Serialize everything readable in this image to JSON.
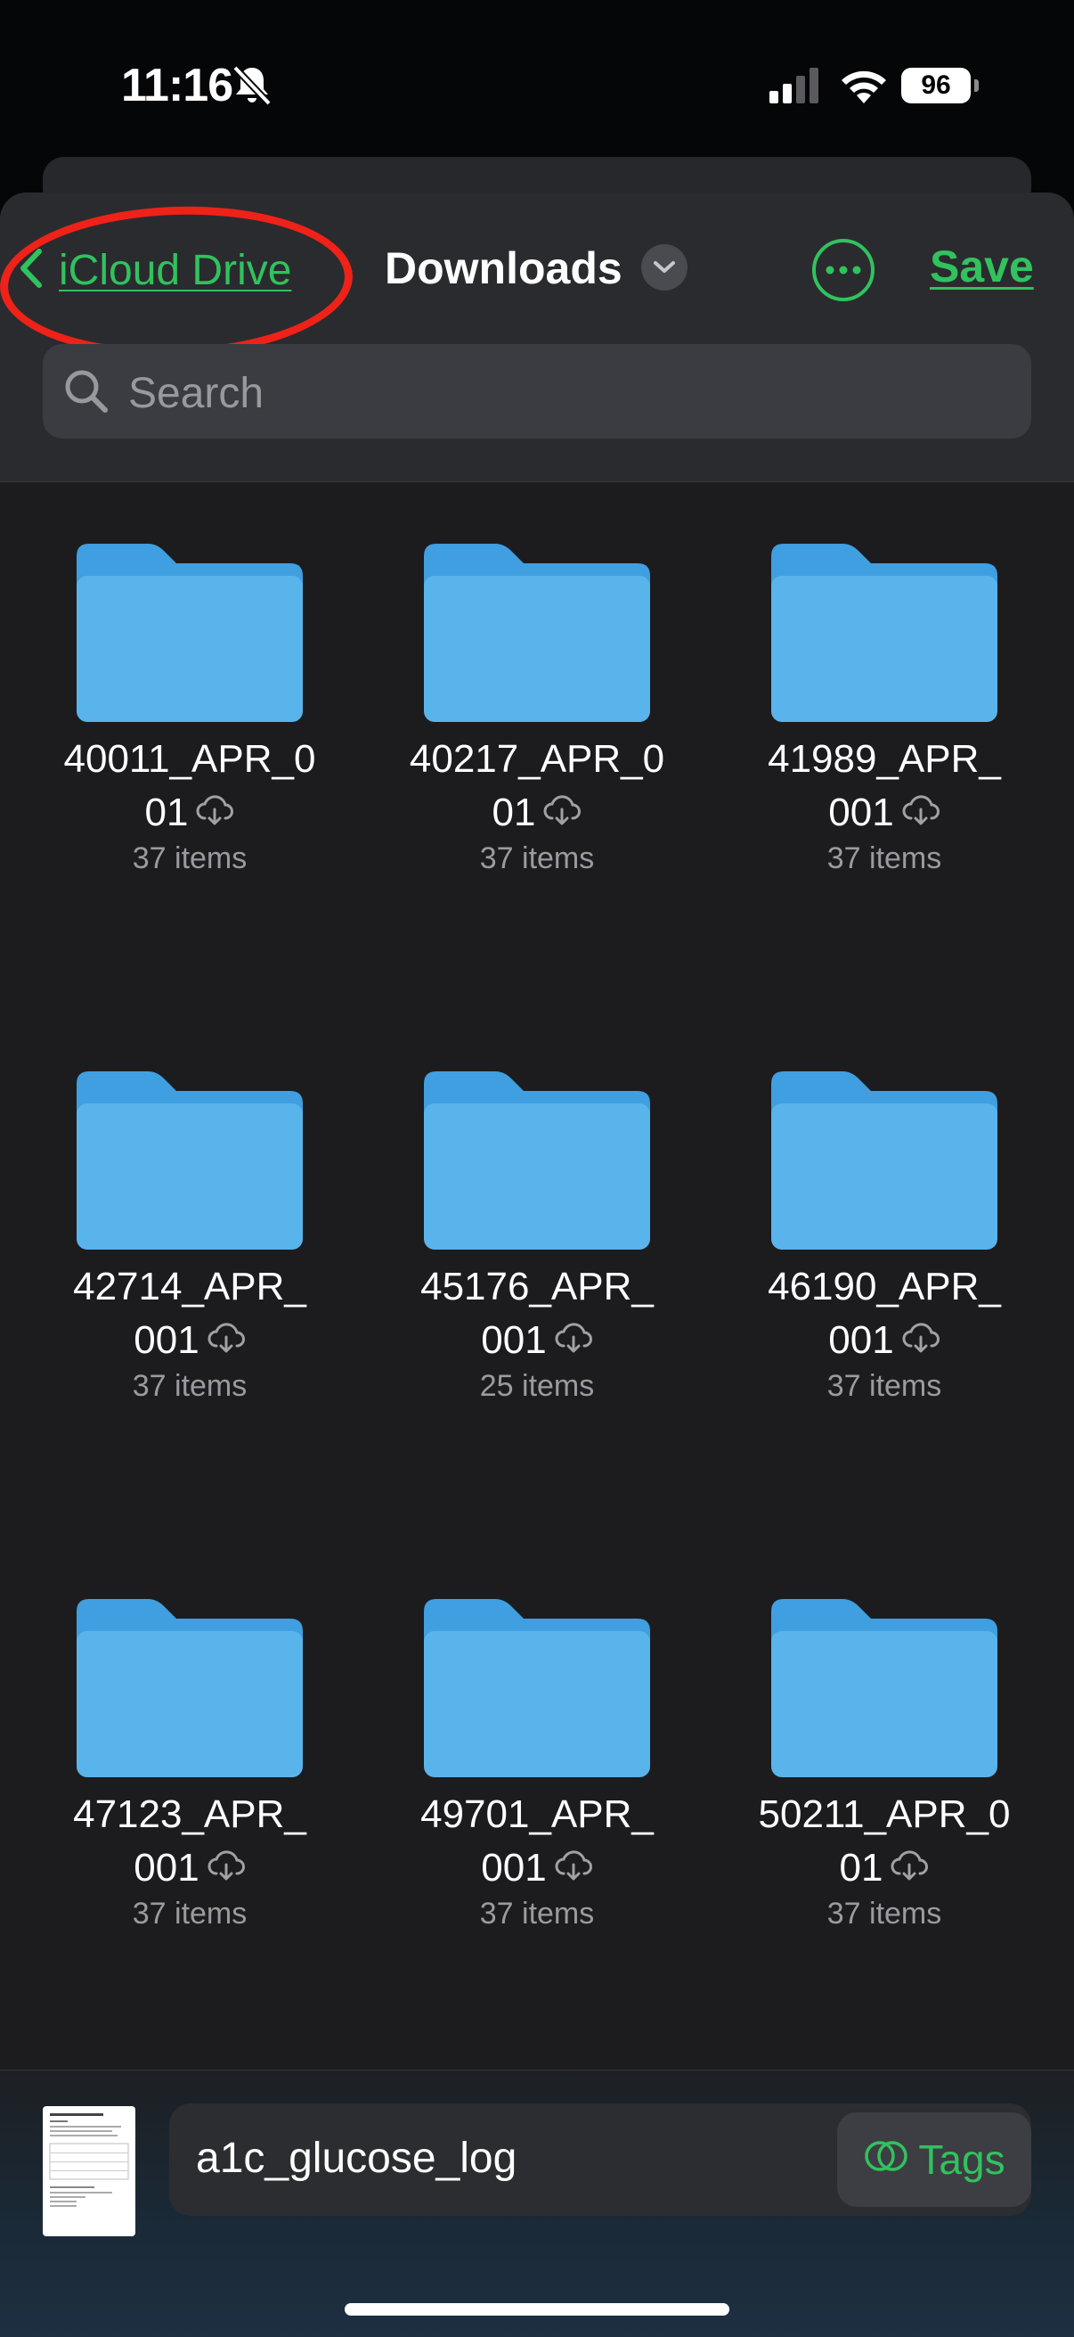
{
  "status_bar": {
    "time": "11:16",
    "battery": "96"
  },
  "nav": {
    "back_label": "iCloud Drive",
    "title": "Downloads",
    "save_label": "Save"
  },
  "search": {
    "placeholder": "Search"
  },
  "folders": [
    {
      "name_line1": "40011_APR_0",
      "name_line2": "01",
      "count": "37 items"
    },
    {
      "name_line1": "40217_APR_0",
      "name_line2": "01",
      "count": "37 items"
    },
    {
      "name_line1": "41989_APR_",
      "name_line2": "001",
      "count": "37 items"
    },
    {
      "name_line1": "42714_APR_",
      "name_line2": "001",
      "count": "37 items"
    },
    {
      "name_line1": "45176_APR_",
      "name_line2": "001",
      "count": "25 items"
    },
    {
      "name_line1": "46190_APR_",
      "name_line2": "001",
      "count": "37 items"
    },
    {
      "name_line1": "47123_APR_",
      "name_line2": "001",
      "count": "37 items"
    },
    {
      "name_line1": "49701_APR_",
      "name_line2": "001",
      "count": "37 items"
    },
    {
      "name_line1": "50211_APR_0",
      "name_line2": "01",
      "count": "37 items"
    }
  ],
  "save_bar": {
    "filename": "a1c_glucose_log",
    "tags_label": "Tags"
  },
  "colors": {
    "accent": "#31c25d",
    "annotation": "#ee2218",
    "folder": "#5ab4ec"
  },
  "icons": [
    "bell-slash-icon",
    "signal-icon",
    "wifi-icon",
    "chevron-left-icon",
    "chevron-down-icon",
    "ellipsis-circle-icon",
    "search-icon",
    "folder-icon",
    "icloud-download-icon",
    "tags-icon"
  ]
}
